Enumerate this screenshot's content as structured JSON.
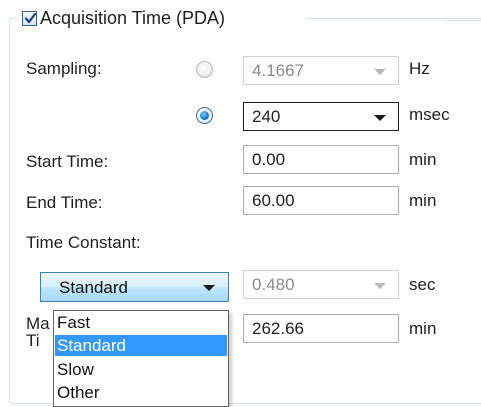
{
  "group": {
    "checkbox_label": "Acquisition Time (PDA)",
    "checked": true
  },
  "sampling": {
    "label": "Sampling:",
    "hz": {
      "value": "4.1667",
      "unit": "Hz",
      "selected": false
    },
    "msec": {
      "value": "240",
      "unit": "msec",
      "selected": true
    }
  },
  "start_time": {
    "label": "Start Time:",
    "value": "0.00",
    "unit": "min"
  },
  "end_time": {
    "label": "End Time:",
    "value": "60.00",
    "unit": "min"
  },
  "time_constant": {
    "label": "Time Constant:",
    "selected": "Standard",
    "value": "0.480",
    "unit": "sec",
    "options": [
      "Fast",
      "Standard",
      "Slow",
      "Other"
    ],
    "highlighted_index": 1
  },
  "max_time": {
    "label_line1": "Ma",
    "label_line2": "Ti",
    "value": "262.66",
    "unit": "min"
  },
  "colors": {
    "accent": "#3399ff",
    "frame": "#d5dfe5",
    "combo_focus_border": "#3c7fb1"
  }
}
